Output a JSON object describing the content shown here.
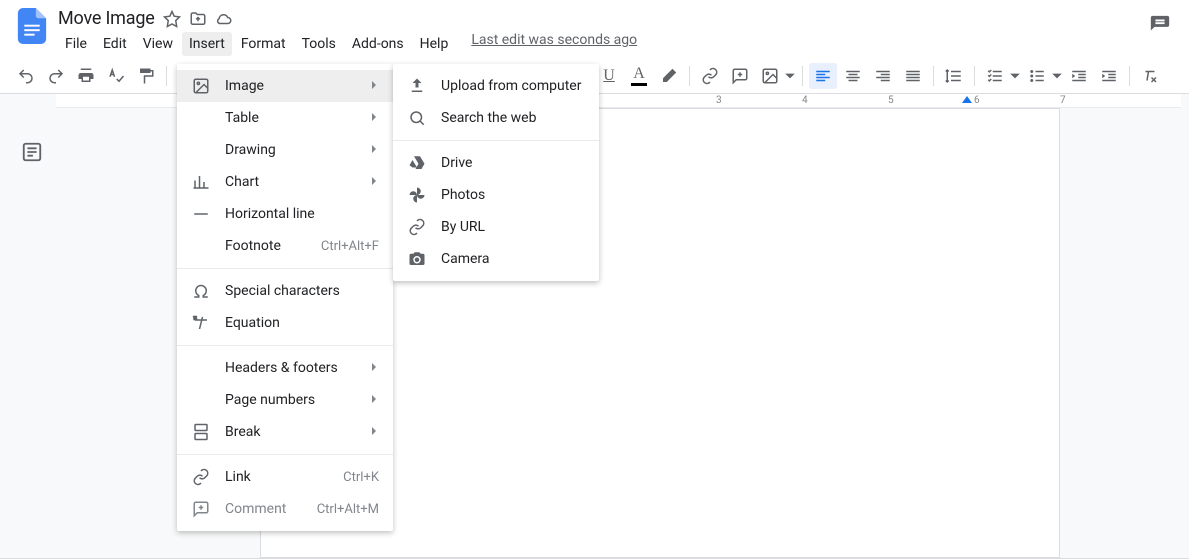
{
  "header": {
    "title": "Move Image",
    "last_edit": "Last edit was seconds ago"
  },
  "menubar": {
    "file": "File",
    "edit": "Edit",
    "view": "View",
    "insert": "Insert",
    "format": "Format",
    "tools": "Tools",
    "addons": "Add-ons",
    "help": "Help"
  },
  "insert_menu": {
    "image": "Image",
    "table": "Table",
    "drawing": "Drawing",
    "chart": "Chart",
    "horizontal_line": "Horizontal line",
    "footnote": "Footnote",
    "footnote_shortcut": "Ctrl+Alt+F",
    "special_characters": "Special characters",
    "equation": "Equation",
    "headers_footers": "Headers & footers",
    "page_numbers": "Page numbers",
    "break": "Break",
    "link": "Link",
    "link_shortcut": "Ctrl+K",
    "comment": "Comment",
    "comment_shortcut": "Ctrl+Alt+M"
  },
  "image_menu": {
    "upload": "Upload from computer",
    "search": "Search the web",
    "drive": "Drive",
    "photos": "Photos",
    "by_url": "By URL",
    "camera": "Camera"
  },
  "ruler_ticks": [
    "3",
    "4",
    "5",
    "6",
    "7"
  ]
}
